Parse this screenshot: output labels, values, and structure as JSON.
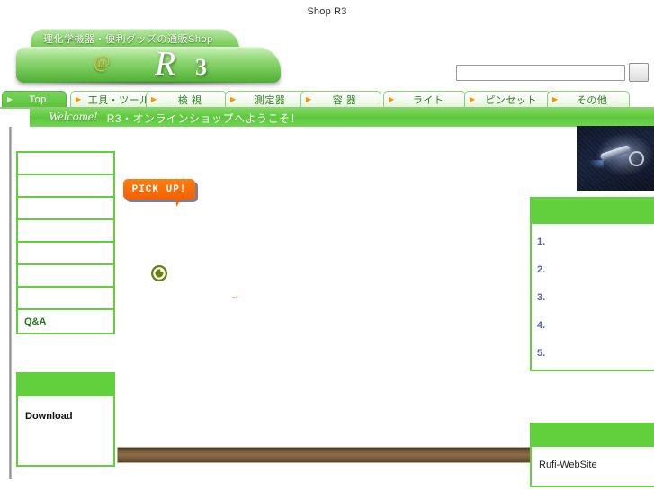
{
  "page": {
    "title": "Shop R3"
  },
  "header": {
    "logo_tagline": "理化学機器・便利グッズの通販Shop",
    "logo_at": "@",
    "logo_mark": "R",
    "logo_number": "3"
  },
  "search": {
    "value": "",
    "placeholder": "",
    "button_label": ""
  },
  "nav": {
    "tabs": [
      {
        "label": "Top",
        "arrow": "▶",
        "active": true
      },
      {
        "label": "工具・ツール",
        "arrow": "▶",
        "active": false
      },
      {
        "label": "検 視",
        "arrow": "▶",
        "active": false
      },
      {
        "label": "測定器",
        "arrow": "▶",
        "active": false
      },
      {
        "label": "容 器",
        "arrow": "▶",
        "active": false
      },
      {
        "label": "ライト",
        "arrow": "▶",
        "active": false
      },
      {
        "label": "ピンセット",
        "arrow": "▶",
        "active": false
      },
      {
        "label": "その他",
        "arrow": "▶",
        "active": false
      }
    ]
  },
  "welcome": {
    "word": "Welcome!",
    "text": "R3・オンラインショップへようこそ！"
  },
  "sidebar": {
    "menu_items": [
      {
        "label": ""
      },
      {
        "label": ""
      },
      {
        "label": ""
      },
      {
        "label": ""
      },
      {
        "label": ""
      },
      {
        "label": ""
      },
      {
        "label": ""
      },
      {
        "label": "Q&A"
      }
    ],
    "download_panel": {
      "header": "",
      "label": "Download"
    }
  },
  "main": {
    "pickup_badge": "PICK UP!",
    "refresh_icon": "circle-arrow-icon",
    "more_arrow": "→"
  },
  "right": {
    "ranking_panel": {
      "header": "",
      "items": [
        {
          "label": "1."
        },
        {
          "label": "2."
        },
        {
          "label": "3."
        },
        {
          "label": "4."
        },
        {
          "label": "5."
        }
      ]
    },
    "link_panel": {
      "header": "",
      "label": "Rufi-WebSite"
    }
  },
  "colors": {
    "accent_green": "#62cf3c",
    "tab_border": "#8dcf76",
    "badge_orange": "#f26000",
    "rank_text": "#5566a8",
    "shelf_brown": "#7a5f3e"
  }
}
